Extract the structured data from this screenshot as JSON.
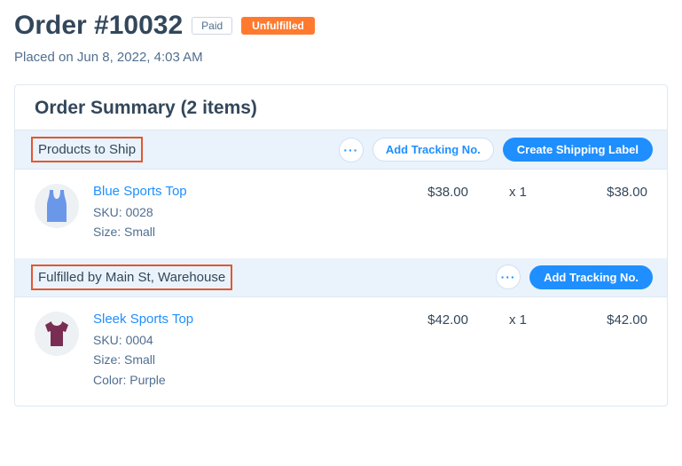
{
  "header": {
    "title": "Order #10032",
    "paid_badge": "Paid",
    "unfulfilled_badge": "Unfulfilled",
    "placed_on": "Placed on Jun 8, 2022, 4:03 AM"
  },
  "summary": {
    "title": "Order Summary (2 items)"
  },
  "sections": [
    {
      "label": "Products to Ship",
      "actions": {
        "more": "···",
        "add_tracking": "Add Tracking No.",
        "create_label": "Create Shipping Label"
      },
      "item": {
        "name": "Blue Sports Top",
        "sku": "SKU: 0028",
        "size": "Size: Small",
        "color": "",
        "price": "$38.00",
        "qty": "x 1",
        "total": "$38.00"
      }
    },
    {
      "label": "Fulfilled by Main St, Warehouse",
      "actions": {
        "more": "···",
        "add_tracking": "Add Tracking No."
      },
      "item": {
        "name": "Sleek Sports Top",
        "sku": "SKU: 0004",
        "size": "Size: Small",
        "color": "Color: Purple",
        "price": "$42.00",
        "qty": "x 1",
        "total": "$42.00"
      }
    }
  ]
}
